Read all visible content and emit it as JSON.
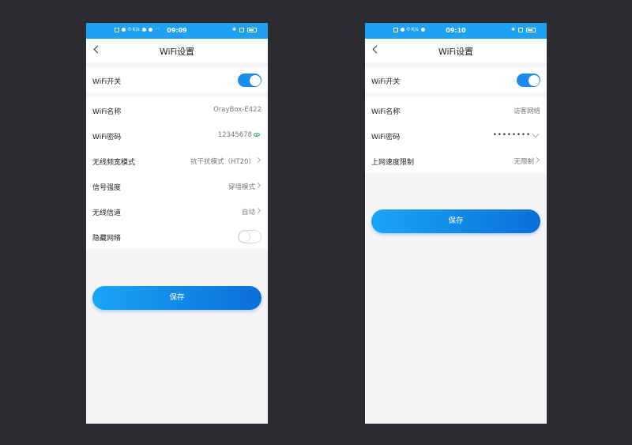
{
  "left": {
    "statusbar": {
      "time": "09:09",
      "speed": "0 K/s",
      "battery": "100"
    },
    "title": "WiFi设置",
    "wifi_switch": {
      "label": "WiFi开关",
      "state": "on"
    },
    "wifi_name": {
      "label": "WiFi名称",
      "value": "OrayBox-E422"
    },
    "wifi_password": {
      "label": "WiFi密码",
      "value": "12345678"
    },
    "bandwidth_mode": {
      "label": "无线频宽模式",
      "value": "抗干扰模式（HT20）"
    },
    "signal_strength": {
      "label": "信号强度",
      "value": "穿墙模式"
    },
    "channel": {
      "label": "无线信道",
      "value": "自动"
    },
    "hidden_network": {
      "label": "隐藏网络",
      "state": "off"
    },
    "save_label": "保存"
  },
  "right": {
    "statusbar": {
      "time": "09:10",
      "speed": "0 K/s",
      "battery": "100"
    },
    "title": "WiFi设置",
    "wifi_switch": {
      "label": "WiFi开关",
      "state": "on"
    },
    "wifi_name": {
      "label": "WiFi名称",
      "value": "访客网络"
    },
    "wifi_password": {
      "label": "WiFi密码",
      "value": "••••••••"
    },
    "speed_limit": {
      "label": "上网速度限制",
      "value": "无限制"
    },
    "save_label": "保存"
  },
  "colors": {
    "accent": "#1a8cf0",
    "statusbar": "#1ea1f3",
    "background": "#2b2b30",
    "eye_icon": "#2fb35a"
  }
}
